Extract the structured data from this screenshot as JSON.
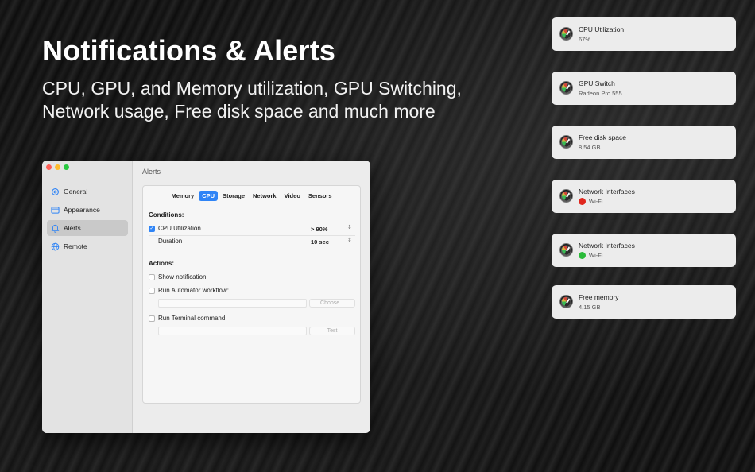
{
  "hero": {
    "title": "Notifications & Alerts",
    "subtitle": "CPU, GPU, and Memory utilization, GPU Switching, Network usage, Free disk space and much more"
  },
  "window": {
    "title": "Alerts",
    "sidebar": [
      {
        "label": "General",
        "icon": "gear-icon"
      },
      {
        "label": "Appearance",
        "icon": "appearance-icon"
      },
      {
        "label": "Alerts",
        "icon": "bell-icon",
        "active": true
      },
      {
        "label": "Remote",
        "icon": "globe-icon"
      }
    ],
    "tabs": [
      "Memory",
      "CPU",
      "Storage",
      "Network",
      "Video",
      "Sensors"
    ],
    "active_tab": "CPU",
    "conditions_label": "Conditions:",
    "conditions": [
      {
        "label": "CPU Utilization",
        "value": "> 90%",
        "checked": true
      },
      {
        "label": "Duration",
        "value": "10 sec"
      }
    ],
    "actions_label": "Actions:",
    "actions": {
      "show_notification": "Show notification",
      "run_automator": "Run Automator workflow:",
      "choose_button": "Choose...",
      "run_terminal": "Run Terminal command:",
      "test_button": "Test"
    }
  },
  "notifications": [
    {
      "title": "CPU Utilization",
      "value": "67%"
    },
    {
      "title": "GPU Switch",
      "value": "Radeon Pro 555"
    },
    {
      "title": "Free disk space",
      "value": "8,54 GB"
    },
    {
      "title": "Network Interfaces",
      "value": "Wi-Fi",
      "status_color": "#e0271e"
    },
    {
      "title": "Network Interfaces",
      "value": "Wi-Fi",
      "status_color": "#2bbb3a"
    },
    {
      "title": "Free memory",
      "value": "4,15 GB"
    }
  ],
  "colors": {
    "accent": "#2f84f6"
  }
}
